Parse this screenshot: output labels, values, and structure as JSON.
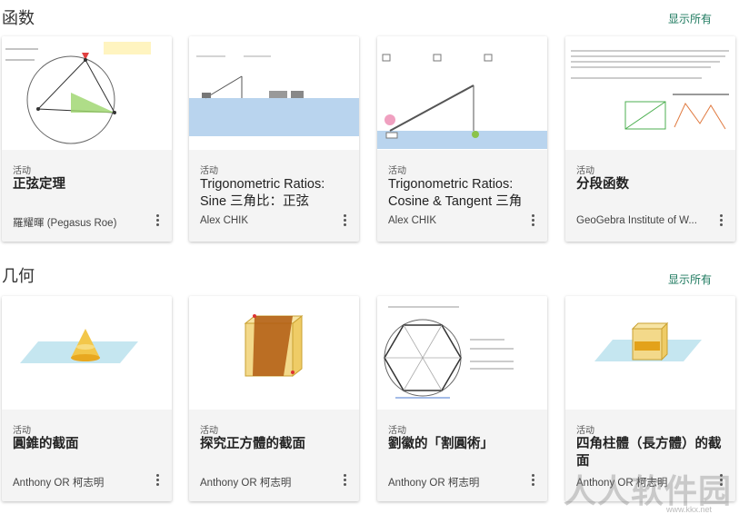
{
  "sections": [
    {
      "title": "函数",
      "show_all": "显示所有",
      "cards": [
        {
          "type": "活动",
          "title": "正弦定理",
          "author": "羅耀暉 (Pegasus Roe)"
        },
        {
          "type": "活动",
          "title": "Trigonometric Ratios: Sine 三角比：正弦",
          "author": "Alex CHIK"
        },
        {
          "type": "活动",
          "title": "Trigonometric Ratios: Cosine & Tangent 三角",
          "author": "Alex CHIK"
        },
        {
          "type": "活动",
          "title": "分段函数",
          "author": "GeoGebra Institute of W..."
        }
      ]
    },
    {
      "title": "几何",
      "show_all": "显示所有",
      "cards": [
        {
          "type": "活动",
          "title": "圓錐的截面",
          "author": "Anthony OR 柯志明"
        },
        {
          "type": "活动",
          "title": "探究正方體的截面",
          "author": "Anthony OR 柯志明"
        },
        {
          "type": "活动",
          "title": "劉徽的「割圓術」",
          "author": "Anthony OR 柯志明"
        },
        {
          "type": "活动",
          "title": "四角柱體（長方體）的截面",
          "author": "Anthony OR 柯志明"
        }
      ]
    }
  ],
  "watermark": {
    "text": "人人软件园",
    "url": "www.kkx.net"
  },
  "colors": {
    "accent": "#1e7a5f",
    "card_bg": "#f4f4f4"
  }
}
